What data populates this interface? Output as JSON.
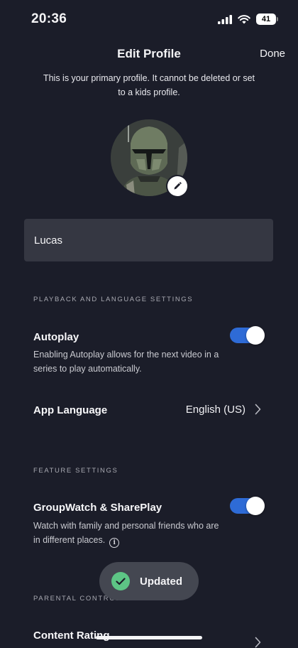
{
  "status_bar": {
    "time": "20:36",
    "battery": "41"
  },
  "nav": {
    "title": "Edit Profile",
    "done_label": "Done"
  },
  "profile": {
    "primary_note": "This is your primary profile. It cannot be deleted or set to a kids profile.",
    "name_value": "Lucas",
    "avatar_icon": "helmet-avatar",
    "edit_icon": "pencil-icon"
  },
  "playback": {
    "header": "PLAYBACK AND LANGUAGE SETTINGS",
    "autoplay": {
      "title": "Autoplay",
      "description": "Enabling Autoplay allows for the next video in a series to play automatically.",
      "enabled": true
    },
    "app_language": {
      "title": "App Language",
      "value": "English (US)"
    }
  },
  "features": {
    "header": "FEATURE SETTINGS",
    "groupwatch": {
      "title": "GroupWatch & SharePlay",
      "description": "Watch with family and personal friends who are in different places.",
      "enabled": true
    }
  },
  "parental": {
    "header": "PARENTAL CONTROLS",
    "content_rating_title": "Content Rating"
  },
  "toast": {
    "label": "Updated"
  },
  "colors": {
    "background": "#1b1d29",
    "toggle_on": "#2e6bd6",
    "toast_check": "#5dc585",
    "field_bg": "#353742"
  }
}
